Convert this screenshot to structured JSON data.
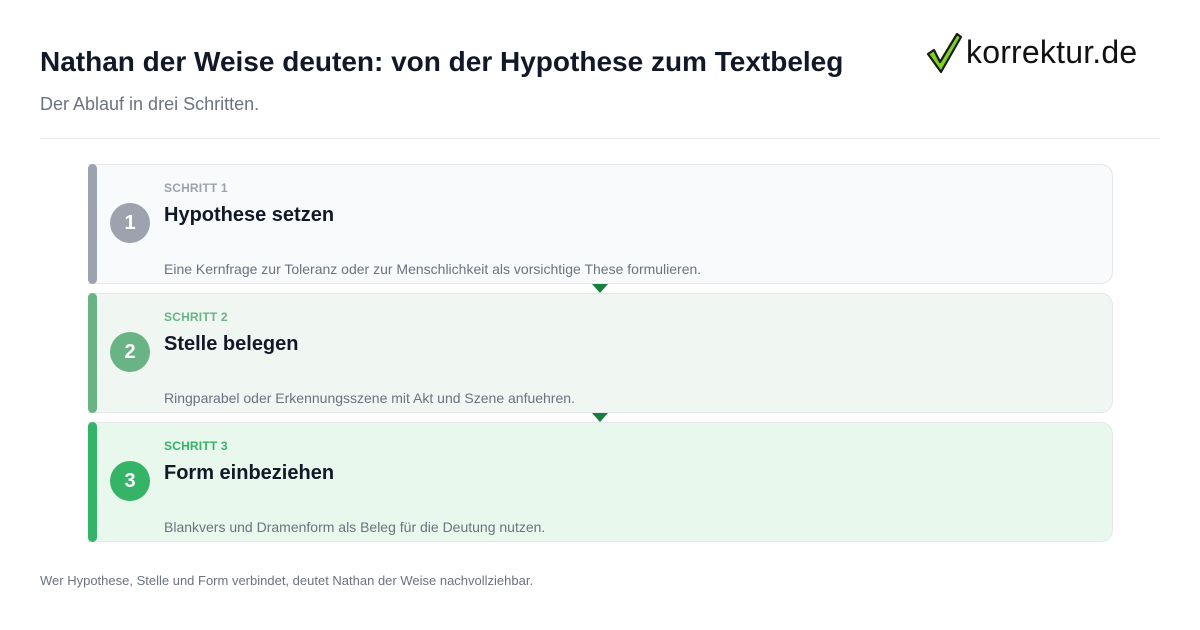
{
  "header": {
    "title": "Nathan der Weise deuten: von der Hypothese zum Textbeleg",
    "subtitle": "Der Ablauf in drei Schritten."
  },
  "logo": {
    "text": "korrektur.de",
    "icon": "checkmark-icon"
  },
  "steps": [
    {
      "number": "1",
      "label": "SCHRITT 1",
      "title": "Hypothese setzen",
      "description": "Eine Kernfrage zur Toleranz oder zur Menschlichkeit als vorsichtige These formulieren.",
      "accent": "#9ca3af",
      "label_color": "#9ca3af",
      "background": "#f8fafc"
    },
    {
      "number": "2",
      "label": "SCHRITT 2",
      "title": "Stelle belegen",
      "description": "Ringparabel oder Erkennungsszene mit Akt und Szene anfuehren.",
      "accent": "#6ab384",
      "label_color": "#6ab384",
      "background": "#f0f6f2"
    },
    {
      "number": "3",
      "label": "SCHRITT 3",
      "title": "Form einbeziehen",
      "description": "Blankvers und Dramenform als Beleg für die Deutung nutzen.",
      "accent": "#35b366",
      "label_color": "#35b366",
      "background": "#e8f8ec"
    }
  ],
  "connector_color": "#15803d",
  "footer": {
    "note": "Wer Hypothese, Stelle und Form verbindet, deutet Nathan der Weise nachvollziehbar."
  }
}
